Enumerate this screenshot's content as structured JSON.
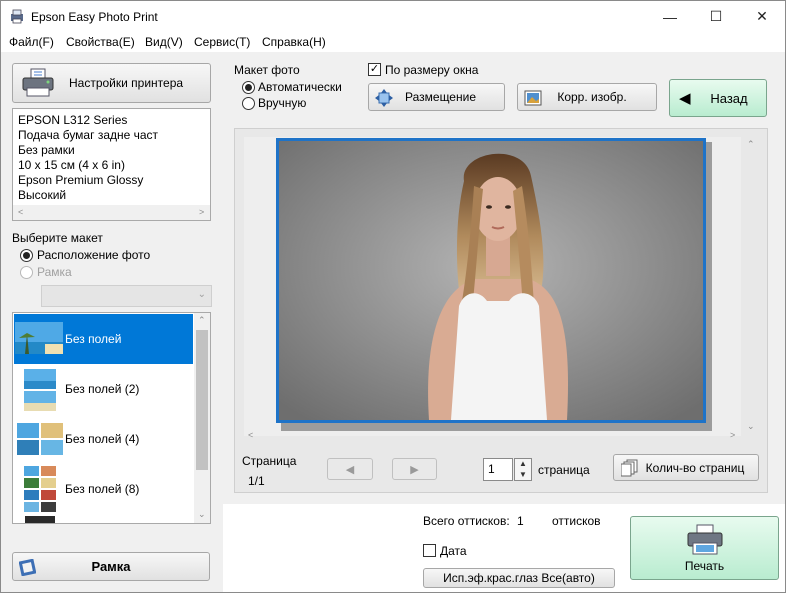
{
  "window": {
    "title": "Epson Easy Photo Print",
    "minimize": "—",
    "maximize": "☐",
    "close": "✕"
  },
  "menu": {
    "items": [
      "Файл(F)",
      "Свойства(E)",
      "Вид(V)",
      "Сервис(T)",
      "Справка(H)"
    ]
  },
  "left_panel": {
    "printer_settings_label": "Настройки принтера",
    "printer_info": [
      "EPSON L312 Series",
      "Подача бумаг задне част",
      "Без рамки",
      "10 x 15 см (4 x 6 in)",
      "Epson Premium Glossy",
      "Высокий"
    ],
    "select_layout_label": "Выберите макет",
    "option_photo_layout": "Расположение фото",
    "option_frame": "Рамка",
    "layouts": [
      "Без полей",
      "Без полей (2)",
      "Без полей (4)",
      "Без полей (8)"
    ],
    "frame_button_label": "Рамка"
  },
  "toolbar": {
    "photo_layout_label": "Макет фото",
    "auto_label": "Автоматически",
    "manual_label": "Вручную",
    "fit_window_label": "По размеру окна",
    "placement_label": "Размещение",
    "correct_image_label": "Корр. изобр.",
    "back_label": "Назад"
  },
  "preview": {
    "page_label": "Страница",
    "page_value": "1/1",
    "copies_value": "1",
    "copies_unit": "страница",
    "pages_count_label": "Колич-во страниц"
  },
  "bottom": {
    "total_prints_label": "Всего оттисков:",
    "total_prints_value": "1",
    "total_prints_unit": "оттисков",
    "date_label": "Дата",
    "redeye_label": "Исп.эф.крас.глаз Все(авто)",
    "print_label": "Печать"
  },
  "colors": {
    "selection_blue": "#0078d7",
    "green_button": "#c4f0d8",
    "preview_border": "#1e73c8"
  }
}
